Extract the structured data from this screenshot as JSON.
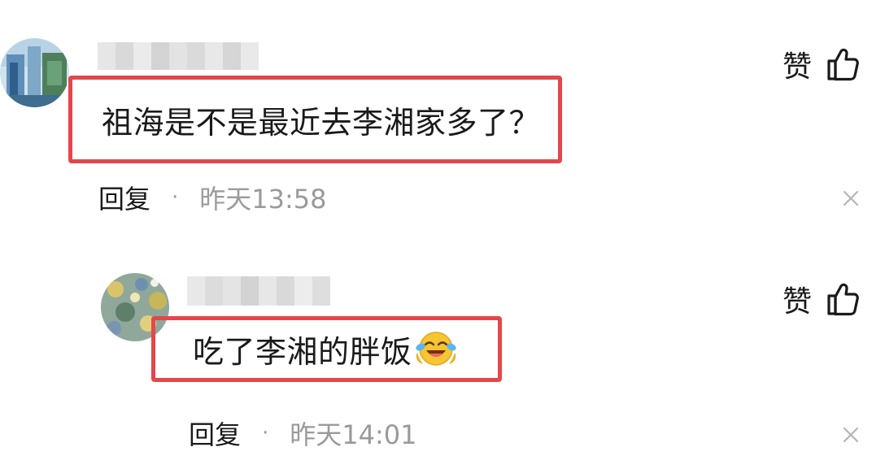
{
  "comments": [
    {
      "text": "祖海是不是最近去李湘家多了？",
      "like_label": "赞",
      "reply_label": "回复",
      "separator": "·",
      "time": "昨天13:58"
    },
    {
      "text": "吃了李湘的胖饭",
      "emoji": "😂",
      "like_label": "赞",
      "reply_label": "回复",
      "separator": "·",
      "time": "昨天14:01"
    }
  ],
  "colors": {
    "highlight_border": "#e2474c",
    "meta_gray": "#9a9a9a",
    "text": "#1a1a1a"
  },
  "icons": [
    "thumbs-up-icon",
    "close-icon",
    "laughing-emoji-icon"
  ]
}
